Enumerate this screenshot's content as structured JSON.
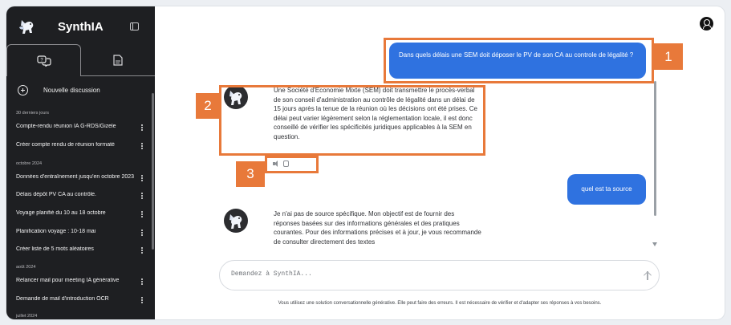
{
  "sidebar": {
    "app_name": "SynthIA",
    "new_discussion_label": "Nouvelle discussion",
    "sections": [
      {
        "title": "30 derniers jours",
        "items": [
          "Compte-rendu réunion IA G-RDS/Gizele",
          "Créer compte rendu de réunion formaté"
        ]
      },
      {
        "title": "octobre 2024",
        "items": [
          "Données d'entraînement jusqu'en octobre 2023",
          "Délais dépôt PV CA au contrôle.",
          "Voyage planifié du 10 au 18 octobre",
          "Planification voyage : 10-18 mai",
          "Créer liste de 5 mots aléatoires"
        ]
      },
      {
        "title": "août 2024",
        "items": [
          "Relancer mail pour meeting IA générative",
          "Demande de mail d'introduction OCR"
        ]
      },
      {
        "title": "juillet 2024",
        "items": []
      }
    ]
  },
  "messages": {
    "user_1": "Dans quels délais une SEM doit déposer le PV de son CA au controle de légalité ?",
    "assistant_1": "Une Société d'Économie Mixte (SEM) doit transmettre le procès-verbal de son conseil d'administration au contrôle de légalité dans un délai de 15 jours après la tenue de la réunion où les décisions ont été prises. Ce délai peut varier légèrement selon la réglementation locale, il est donc conseillé de vérifier les spécificités juridiques applicables à la SEM en question.",
    "user_2": "quel est ta source",
    "assistant_2": "Je n'ai pas de source spécifique. Mon objectif est de fournir des réponses basées sur des informations générales et des pratiques courantes. Pour des informations précises et à jour, je vous recommande de consulter directement des textes"
  },
  "input": {
    "placeholder": "Demandez à SynthIA..."
  },
  "disclaimer": "Vous utilisez une solution conversationnelle générative. Elle peut faire des erreurs. Il est nécessaire de vérifier et d'adapter ses réponses à vos besoins.",
  "annotations": [
    "1",
    "2",
    "3"
  ],
  "colors": {
    "sidebar_bg": "#1e1f22",
    "user_bubble": "#2f72e0",
    "annotation": "#e8793a"
  },
  "icons": {
    "logo": "pegasus-logo-icon",
    "panel_toggle": "sidebar-toggle-icon",
    "chat_tab": "chat-bubbles-icon",
    "doc_tab": "document-icon",
    "new": "plus-circle-icon",
    "account": "account-icon",
    "send": "arrow-up-icon",
    "speak": "speaker-icon",
    "copy": "copy-icon"
  }
}
